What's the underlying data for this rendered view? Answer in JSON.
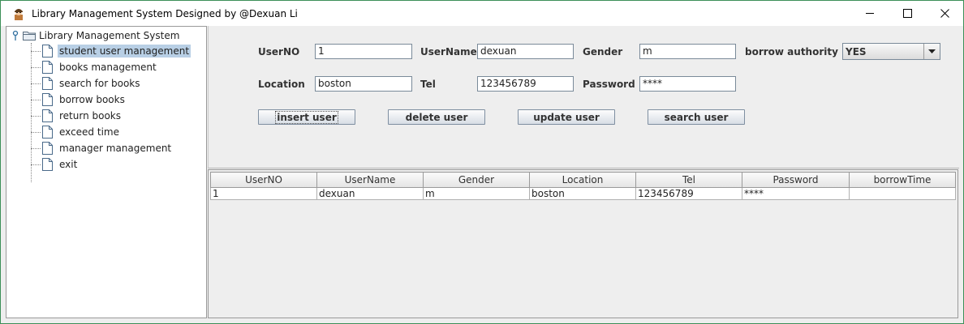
{
  "window": {
    "title": "Library Management System Designed by @Dexuan Li",
    "icon": "librarian-avatar-icon",
    "controls": {
      "minimize_icon": "minimize-icon",
      "maximize_icon": "maximize-icon",
      "close_icon": "close-icon"
    }
  },
  "tree": {
    "root_label": "Library Management System",
    "root_icon": "folder-icon",
    "items": [
      {
        "label": "student user management",
        "icon": "document-icon",
        "selected": true
      },
      {
        "label": "books management",
        "icon": "document-icon",
        "selected": false
      },
      {
        "label": "search for books",
        "icon": "document-icon",
        "selected": false
      },
      {
        "label": "borrow books",
        "icon": "document-icon",
        "selected": false
      },
      {
        "label": "return books",
        "icon": "document-icon",
        "selected": false
      },
      {
        "label": "exceed time",
        "icon": "document-icon",
        "selected": false
      },
      {
        "label": "manager management",
        "icon": "document-icon",
        "selected": false
      },
      {
        "label": "exit",
        "icon": "document-icon",
        "selected": false
      }
    ]
  },
  "form": {
    "userno_label": "UserNO",
    "userno_value": "1",
    "username_label": "UserName",
    "username_value": "dexuan",
    "gender_label": "Gender",
    "gender_value": "m",
    "borrow_authority_label": "borrow authority",
    "borrow_authority_value": "YES",
    "location_label": "Location",
    "location_value": "boston",
    "tel_label": "Tel",
    "tel_value": "123456789",
    "password_label": "Password",
    "password_value": "****"
  },
  "buttons": {
    "insert": "insert user",
    "delete": "delete user",
    "update": "update user",
    "search": "search user"
  },
  "table": {
    "columns": [
      "UserNO",
      "UserName",
      "Gender",
      "Location",
      "Tel",
      "Password",
      "borrowTime"
    ],
    "rows": [
      [
        "1",
        "dexuan",
        "m",
        "boston",
        "123456789",
        "****",
        ""
      ]
    ]
  },
  "colors": {
    "selection": "#b8cfe5",
    "window_border": "#3c8f58",
    "panel_bg": "#eeeeee"
  }
}
